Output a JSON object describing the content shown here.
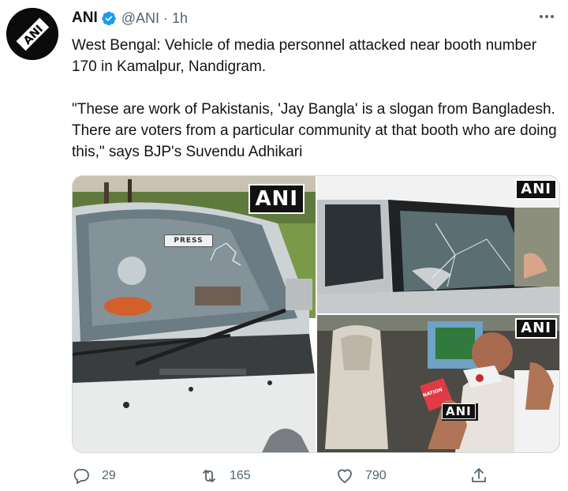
{
  "tweet": {
    "author_name": "ANI",
    "handle": "@ANI",
    "time": "· 1h",
    "avatar_text": "ANI",
    "text_paragraphs": [
      "West Bengal: Vehicle of media personnel attacked near booth number 170 in Kamalpur, Nandigram.",
      "\"These are work of Pakistanis, 'Jay Bangla' is a slogan from Bangladesh. There are voters from a particular community at that booth who are doing this,\" says BJP's Suvendu Adhikari"
    ]
  },
  "media": {
    "photo1": {
      "badge": "ANI",
      "sticker": "PRESS"
    },
    "photo2": {
      "badge": "ANI"
    },
    "photo3": {
      "badge": "ANI",
      "mic_label": "ANI"
    }
  },
  "actions": {
    "reply_count": "29",
    "retweet_count": "165",
    "like_count": "790"
  },
  "icons": {
    "verified": "verified-badge-icon",
    "more": "more-options-icon",
    "reply": "reply-icon",
    "retweet": "retweet-icon",
    "like": "heart-icon",
    "share": "share-icon"
  },
  "colors": {
    "verified": "#1d9bf0",
    "text": "#0f1419",
    "muted": "#536471"
  }
}
